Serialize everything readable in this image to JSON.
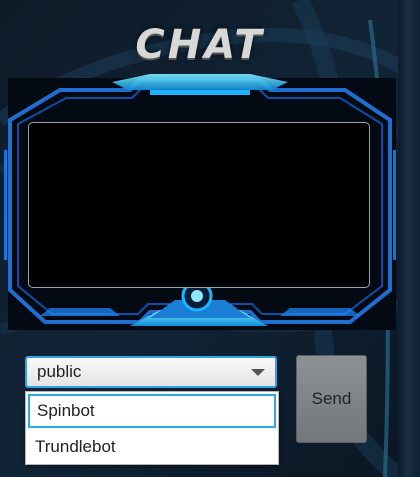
{
  "title": "CHAT",
  "chat": {
    "messages": []
  },
  "recipient_select": {
    "selected": "public",
    "options": [
      "Spinbot",
      "Trundlebot"
    ],
    "highlighted_option": "Spinbot"
  },
  "send_button": {
    "label": "Send"
  },
  "colors": {
    "frame_accent": "#1fb4ff",
    "focus_ring": "#2fa5e8",
    "chat_bg": "#000000"
  }
}
